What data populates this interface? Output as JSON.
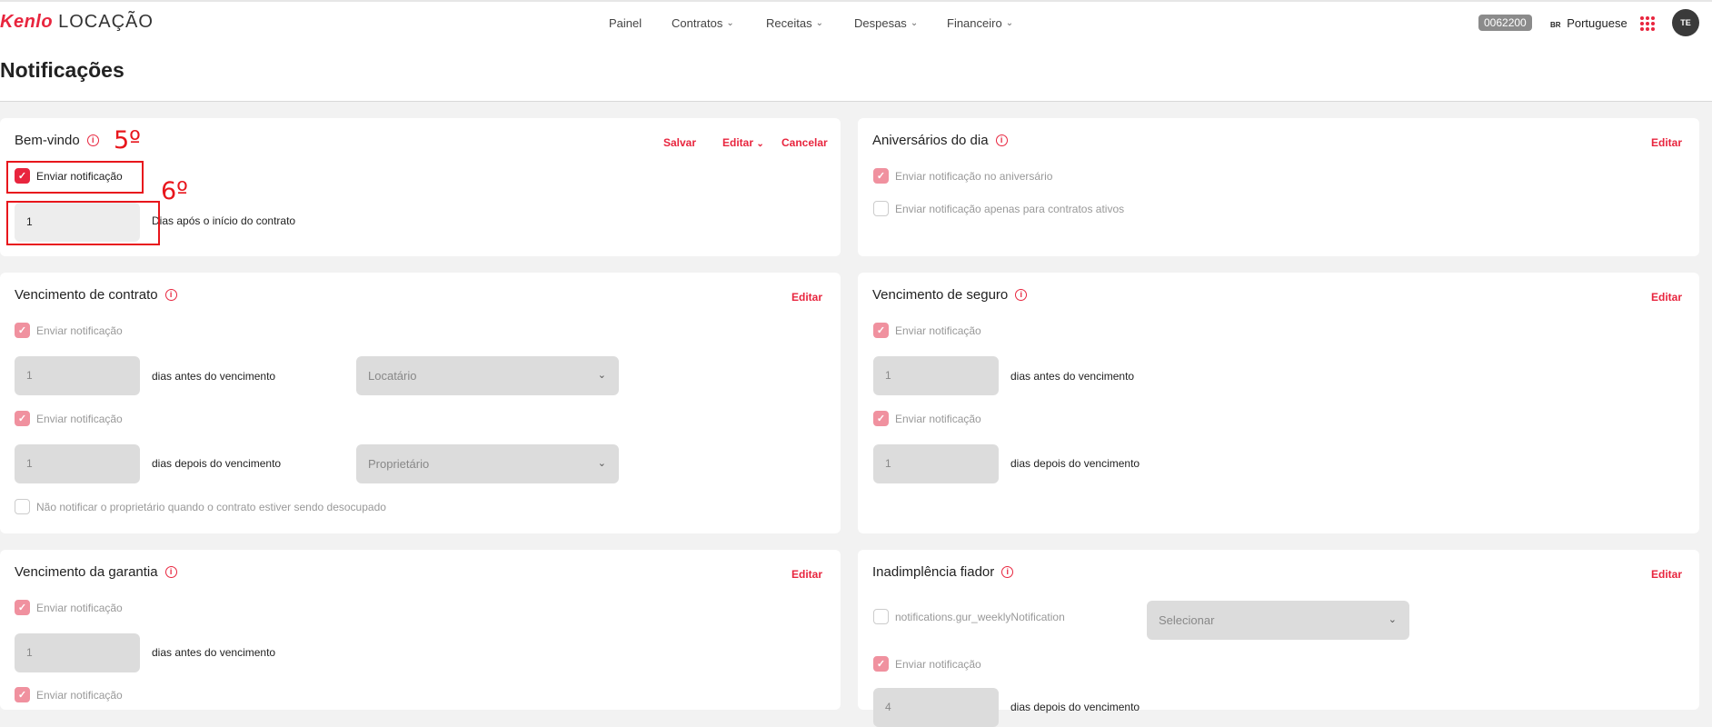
{
  "header": {
    "brand": "Kenlo",
    "product": "LOCAÇÃO",
    "nav": [
      {
        "label": "Painel",
        "has_chevron": false
      },
      {
        "label": "Contratos",
        "has_chevron": true
      },
      {
        "label": "Receitas",
        "has_chevron": true
      },
      {
        "label": "Despesas",
        "has_chevron": true
      },
      {
        "label": "Financeiro",
        "has_chevron": true
      }
    ],
    "account_code": "0062200",
    "language_flag": "BR",
    "language": "Portuguese",
    "avatar_initials": "TE"
  },
  "page": {
    "title": "Notificações"
  },
  "annotations": {
    "step5": "5º",
    "step6": "6º"
  },
  "cards": {
    "welcome": {
      "title": "Bem-vindo",
      "save": "Salvar",
      "edit": "Editar",
      "cancel": "Cancelar",
      "notify_label": "Enviar notificação",
      "notify_checked": true,
      "days_value": "1",
      "days_label": "Dias após o início do contrato"
    },
    "birthdays": {
      "title": "Aniversários do dia",
      "edit": "Editar",
      "opt1": "Enviar notificação no aniversário",
      "opt1_checked": true,
      "opt2": "Enviar notificação apenas para contratos ativos",
      "opt2_checked": false
    },
    "contract_expiry": {
      "title": "Vencimento de contrato",
      "edit": "Editar",
      "notify1": "Enviar notificação",
      "days_before_value": "1",
      "days_before_label": "dias antes do vencimento",
      "select1": "Locatário",
      "notify2": "Enviar notificação",
      "days_after_value": "1",
      "days_after_label": "dias depois do vencimento",
      "select2": "Proprietário",
      "vacate_label": "Não notificar o proprietário quando o contrato estiver sendo desocupado"
    },
    "insurance_expiry": {
      "title": "Vencimento de seguro",
      "edit": "Editar",
      "notify1": "Enviar notificação",
      "days_before_value": "1",
      "days_before_label": "dias antes do vencimento",
      "notify2": "Enviar notificação",
      "days_after_value": "1",
      "days_after_label": "dias depois do vencimento"
    },
    "guarantee_expiry": {
      "title": "Vencimento da garantia",
      "edit": "Editar",
      "notify1": "Enviar notificação",
      "days_before_value": "1",
      "days_before_label": "dias antes do vencimento",
      "notify2": "Enviar notificação"
    },
    "guarantor_default": {
      "title": "Inadimplência fiador",
      "edit": "Editar",
      "weekly_label": "notifications.gur_weeklyNotification",
      "weekly_select": "Selecionar",
      "notify": "Enviar notificação",
      "days_after_value": "4",
      "days_after_label": "dias depois do vencimento"
    }
  },
  "colors": {
    "accent": "#e8253e",
    "annotation": "#e8161c"
  }
}
